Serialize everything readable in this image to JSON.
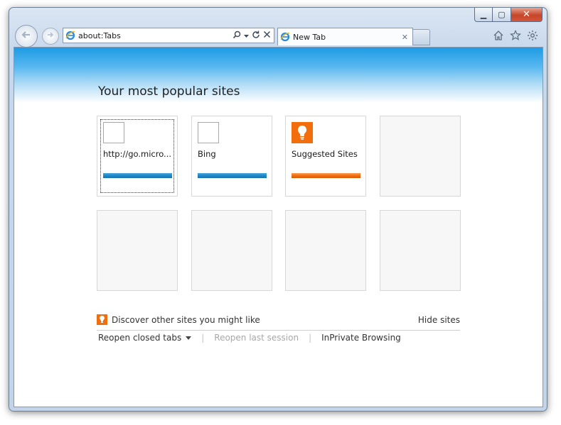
{
  "window": {
    "caption": {
      "minimize": "▁",
      "maximize": "▢",
      "close": "✕"
    }
  },
  "address_bar": {
    "url": "about:Tabs"
  },
  "tab": {
    "label": "New Tab",
    "close": "✕"
  },
  "page": {
    "heading": "Your most popular sites",
    "tiles": [
      {
        "label": "http://go.micro...",
        "bar_color": "#1e88c9",
        "icon": "blank-favicon-icon"
      },
      {
        "label": "Bing",
        "bar_color": "#1e88c9",
        "icon": "blank-favicon-icon"
      },
      {
        "label": "Suggested Sites",
        "bar_color": "#f26e0d",
        "icon": "lightbulb-icon"
      }
    ],
    "discover_text": "Discover other sites you might like",
    "hide_sites": "Hide sites",
    "links": {
      "reopen_closed_tabs": "Reopen closed tabs",
      "reopen_last_session": "Reopen last session",
      "inprivate": "InPrivate Browsing"
    }
  },
  "colors": {
    "accent_blue": "#1e88c9",
    "suggested_orange": "#f26e0d",
    "banner_blue": "#1d9be5"
  }
}
